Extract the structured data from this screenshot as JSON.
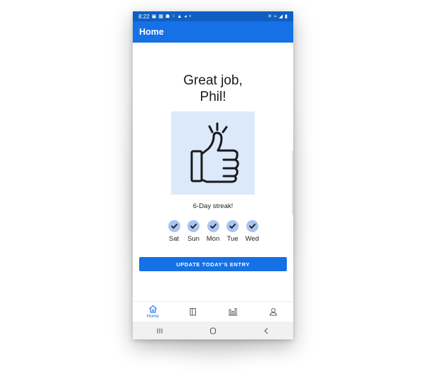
{
  "status_bar": {
    "time": "8:22",
    "left_icons": [
      "shopping-bag-icon",
      "calendar-icon",
      "share-icon",
      "usb-icon",
      "warning-icon",
      "android-icon",
      "dot-icon"
    ],
    "right_icons": [
      "mute-icon",
      "wifi-icon",
      "signal-icon",
      "battery-icon"
    ]
  },
  "app_bar": {
    "title": "Home"
  },
  "main": {
    "greeting_line1": "Great job,",
    "greeting_line2": "Phil!",
    "illustration": "thumbs-up-icon",
    "streak_text": "6-Day streak!",
    "days": [
      {
        "label": "Sat",
        "done": true
      },
      {
        "label": "Sun",
        "done": true
      },
      {
        "label": "Mon",
        "done": true
      },
      {
        "label": "Tue",
        "done": true
      },
      {
        "label": "Wed",
        "done": true
      }
    ],
    "update_button": "UPDATE TODAY'S ENTRY"
  },
  "bottom_nav": [
    {
      "label": "Home",
      "icon": "home-icon",
      "active": true
    },
    {
      "label": "",
      "icon": "journal-icon",
      "active": false
    },
    {
      "label": "",
      "icon": "bar-chart-icon",
      "active": false
    },
    {
      "label": "",
      "icon": "profile-icon",
      "active": false
    }
  ],
  "system_nav": [
    "recent-apps-icon",
    "home-button-icon",
    "back-icon"
  ],
  "colors": {
    "primary": "#1670e6",
    "status_bar": "#0f5fc2",
    "illustration_bg": "#dce9fb",
    "check_circle": "#a9c3f2"
  }
}
